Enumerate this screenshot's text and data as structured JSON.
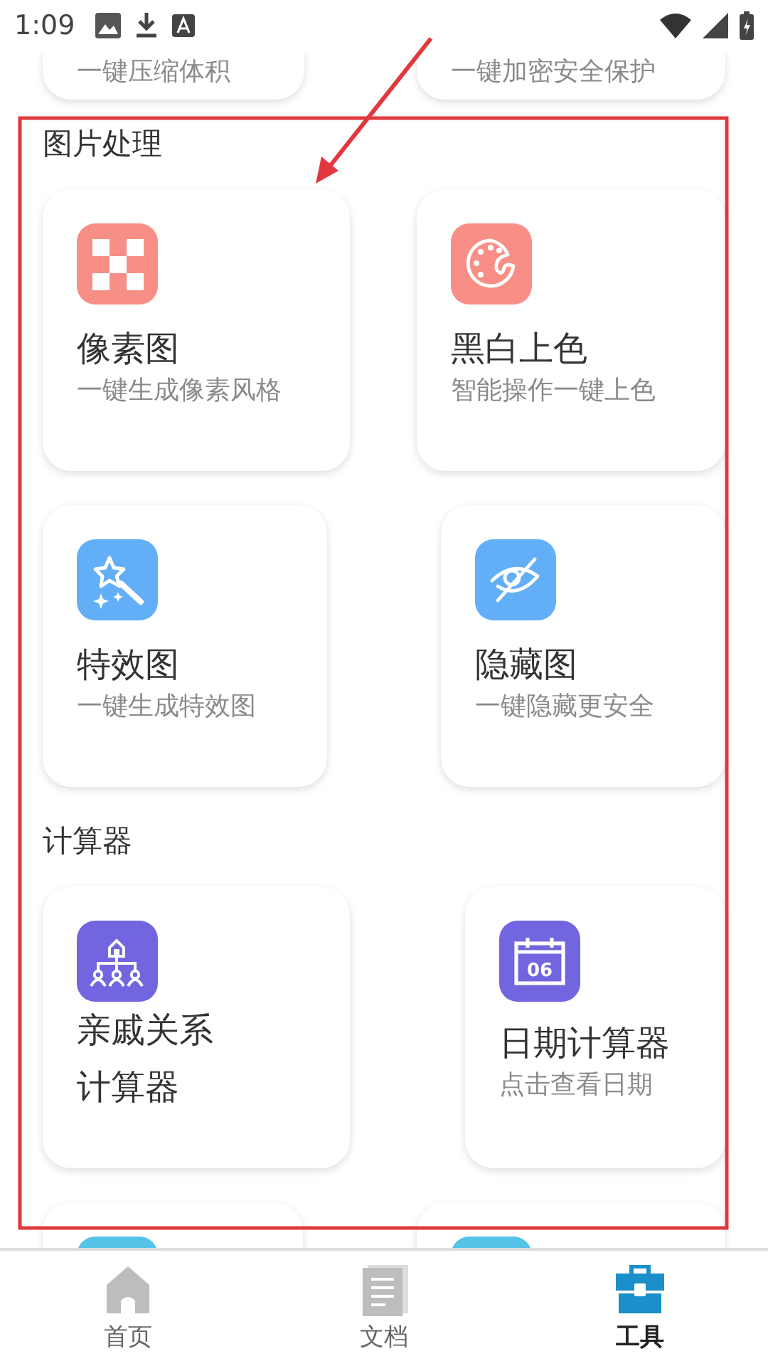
{
  "status_bar": {
    "time": "1:09"
  },
  "top_cards": [
    {
      "subtitle": "一键压缩体积"
    },
    {
      "subtitle": "一键加密安全保护"
    }
  ],
  "sections": [
    {
      "title": "图片处理",
      "rows": [
        [
          {
            "kind": "pixel",
            "color": "#f78f86",
            "title": "像素图",
            "subtitle": "一键生成像素风格"
          },
          {
            "kind": "palette",
            "color": "#f78f86",
            "title": "黑白上色",
            "subtitle": "智能操作一键上色"
          }
        ],
        [
          {
            "kind": "wand",
            "color": "#63aff7",
            "title": "特效图",
            "subtitle": "一键生成特效图"
          },
          {
            "kind": "eye-off",
            "color": "#63aff7",
            "title": "隐藏图",
            "subtitle": "一键隐藏更安全"
          }
        ]
      ]
    },
    {
      "title": "计算器",
      "rows": [
        [
          {
            "kind": "family-tree",
            "color": "#7165e0",
            "title_lines": [
              "亲戚关系",
              "计算器"
            ]
          },
          {
            "kind": "calendar",
            "color": "#7165e0",
            "icon_text": "06",
            "title": "日期计算器",
            "subtitle": "点击查看日期"
          }
        ],
        [
          {
            "kind": "partial",
            "color": "#55c3e6"
          },
          {
            "kind": "partial",
            "color": "#55c3e6"
          }
        ]
      ]
    }
  ],
  "nav": [
    {
      "kind": "home",
      "label": "首页",
      "selected": false
    },
    {
      "kind": "docs",
      "label": "文档",
      "selected": false
    },
    {
      "kind": "toolbox",
      "label": "工具",
      "selected": true
    }
  ],
  "annotation": {
    "color": "#e0383e"
  }
}
